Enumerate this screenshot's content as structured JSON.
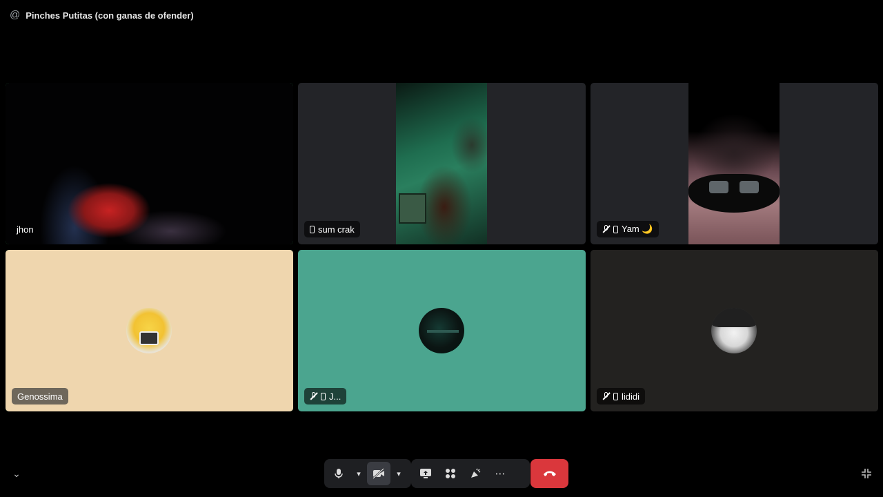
{
  "header": {
    "icon": "at-icon",
    "title": "Pinches Putitas (con ganas de ofender)"
  },
  "participants": [
    {
      "name": "jhon",
      "speaking": true,
      "video": true
    },
    {
      "name": "sum crak",
      "mobile": true,
      "video": true
    },
    {
      "name": "Yam 🌙",
      "mobile": true,
      "muted": true,
      "video": true
    },
    {
      "name": "Genossima",
      "speaking": true,
      "video": false,
      "bg": "#efd6ae"
    },
    {
      "name": "J...",
      "mobile": true,
      "muted": true,
      "video": false,
      "bg": "#4ba58f"
    },
    {
      "name": "lididi",
      "mobile": true,
      "muted": true,
      "video": false,
      "bg": "#232220"
    }
  ],
  "controls": {
    "microphone": "microphone-icon",
    "camera": "camera-off-icon",
    "screen_share": "screen-share-icon",
    "activities": "activities-icon",
    "soundboard": "soundboard-icon",
    "more": "⋯",
    "hangup": "hangup-icon",
    "collapse": "chevron-down-icon",
    "fullscreen": "exit-fullscreen-icon"
  },
  "colors": {
    "speaking_ring": "#3ba55c",
    "hangup": "#da373c"
  }
}
